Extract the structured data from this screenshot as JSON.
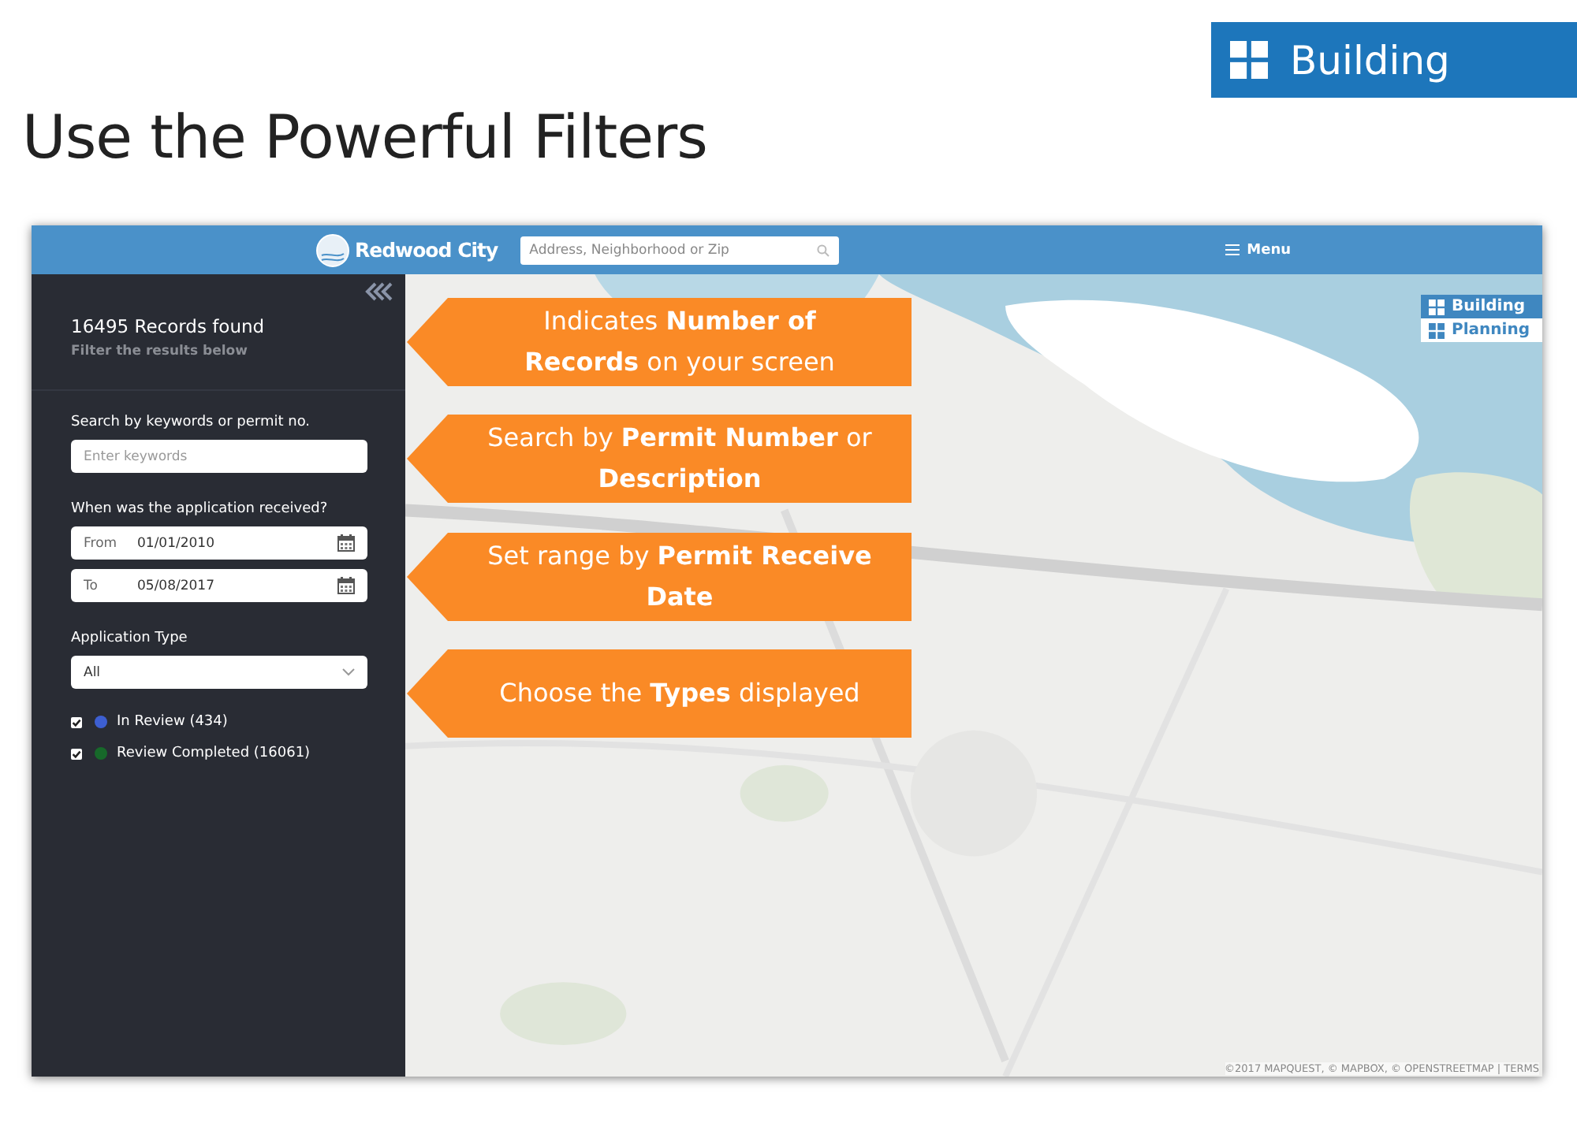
{
  "slide": {
    "badge": "Building",
    "title": "Use the Powerful Filters"
  },
  "app": {
    "logo": "Redwood City",
    "search": {
      "placeholder": "Address, Neighborhood or Zip"
    },
    "menu": "Menu",
    "sidebar": {
      "count": "16495 Records found",
      "hint": "Filter the results below",
      "keyword_label": "Search by keywords or permit no.",
      "keyword_field": {
        "placeholder": "Enter keywords"
      },
      "date_label": "When was the application received?",
      "dates": [
        {
          "label": "From",
          "value": "01/01/2010"
        },
        {
          "label": "To",
          "value": "05/08/2017"
        }
      ],
      "type_label": "Application Type",
      "type_select": "All",
      "statuses": [
        {
          "label": "In Review (434)",
          "checked": true,
          "color": "#3d5fd1"
        },
        {
          "label": "Review Completed (16061)",
          "checked": true,
          "color": "#17692a"
        }
      ]
    },
    "layers": [
      {
        "label": "Building",
        "selected": true
      },
      {
        "label": "Planning",
        "selected": false
      }
    ],
    "attribution": "©2017 MAPQUEST, © MAPBOX, © OPENSTREETMAP | TERMS"
  },
  "callouts": [
    "Indicates **Number of Records** on your screen",
    "Search by **Permit Number** or **Description**",
    "Set range by **Permit Receive Date**",
    "Choose the **Types** displayed"
  ]
}
